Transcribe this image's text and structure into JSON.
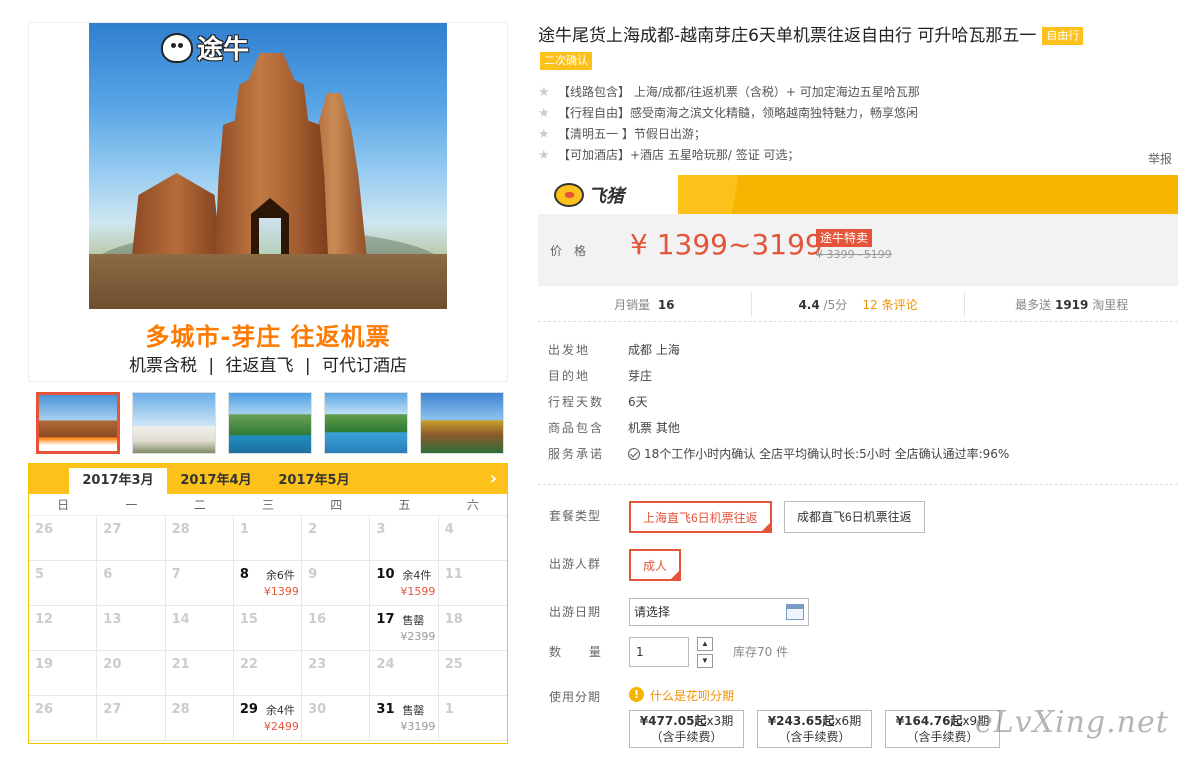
{
  "hero": {
    "logo_text": "途牛",
    "banner_title": "多城市-芽庄  往返机票",
    "banner_sub": "机票含税  |  往返直飞  |  可代订酒店"
  },
  "calendar": {
    "tabs": [
      "2017年3月",
      "2017年4月",
      "2017年5月"
    ],
    "active_tab": 0,
    "next_icon": "›",
    "weekdays": [
      "日",
      "一",
      "二",
      "三",
      "四",
      "五",
      "六"
    ],
    "cells": [
      {
        "day": "26"
      },
      {
        "day": "27"
      },
      {
        "day": "28"
      },
      {
        "day": "1"
      },
      {
        "day": "2"
      },
      {
        "day": "3"
      },
      {
        "day": "4"
      },
      {
        "day": "5"
      },
      {
        "day": "6"
      },
      {
        "day": "7"
      },
      {
        "day": "8",
        "stock": "余6件",
        "price": "¥1399"
      },
      {
        "day": "9"
      },
      {
        "day": "10",
        "stock": "余4件",
        "price": "¥1599"
      },
      {
        "day": "11"
      },
      {
        "day": "12"
      },
      {
        "day": "13"
      },
      {
        "day": "14"
      },
      {
        "day": "15"
      },
      {
        "day": "16"
      },
      {
        "day": "17",
        "stock": "售罄",
        "price": "¥2399",
        "sold": true
      },
      {
        "day": "18"
      },
      {
        "day": "19"
      },
      {
        "day": "20"
      },
      {
        "day": "21"
      },
      {
        "day": "22"
      },
      {
        "day": "23"
      },
      {
        "day": "24"
      },
      {
        "day": "25"
      },
      {
        "day": "26"
      },
      {
        "day": "27"
      },
      {
        "day": "28"
      },
      {
        "day": "29",
        "stock": "余4件",
        "price": "¥2499"
      },
      {
        "day": "30"
      },
      {
        "day": "31",
        "stock": "售罄",
        "price": "¥3199",
        "sold": true
      },
      {
        "day": "1"
      }
    ]
  },
  "product": {
    "title": "途牛尾货上海成都-越南芽庄6天单机票往返自由行 可升哈瓦那五一",
    "tag1": "自由行",
    "tag2": "二次确认",
    "features": [
      "【线路包含】 上海/成都/往返机票（含税）+ 可加定海边五星哈瓦那",
      "【行程自由】感受南海之滨文化精髓，领略越南独特魅力，畅享悠闲",
      "【清明五一 】节假日出游；",
      "【可加酒店】+酒店 五星哈玩那/ 签证 可选；"
    ],
    "feature_icon": "star-icon",
    "report": "举报"
  },
  "platform": {
    "name": "飞猪"
  },
  "price": {
    "label": "价格",
    "value": "¥ 1399~3199",
    "badge": "途牛特卖",
    "original": "¥ 3399~5199"
  },
  "stats": {
    "sales_label": "月销量",
    "sales_value": "16",
    "rating_value": "4.4",
    "rating_suffix": "/5分",
    "reviews": "12 条评论",
    "points_prefix": "最多送",
    "points_value": "1919",
    "points_suffix": "淘里程"
  },
  "info": [
    {
      "label": "出发地",
      "value": "成都   上海"
    },
    {
      "label": "目的地",
      "value": "芽庄"
    },
    {
      "label": "行程天数",
      "value": "6天"
    },
    {
      "label": "商品包含",
      "value": "机票   其他"
    },
    {
      "label": "服务承诺",
      "value": "18个工作小时内确认    全店平均确认时长:5小时    全店确认通过率:96%"
    }
  ],
  "options": {
    "package_label": "套餐类型",
    "package_1": "上海直飞6日机票往返",
    "package_2": "成都直飞6日机票往返",
    "crowd_label": "出游人群",
    "crowd_1": "成人",
    "date_label": "出游日期",
    "date_value": "请选择",
    "qty_label": "数  量",
    "qty_value": "1",
    "stock": "库存70 件",
    "installment_label": "使用分期",
    "huabei_link": "什么是花呗分期",
    "installments": [
      {
        "amount": "¥477.05起",
        "periods": "x3期",
        "note": "（含手续费）"
      },
      {
        "amount": "¥243.65起",
        "periods": "x6期",
        "note": "（含手续费）"
      },
      {
        "amount": "¥164.76起",
        "periods": "x9期",
        "note": "（含手续费）"
      }
    ]
  },
  "watermark": "eLvXing.net"
}
